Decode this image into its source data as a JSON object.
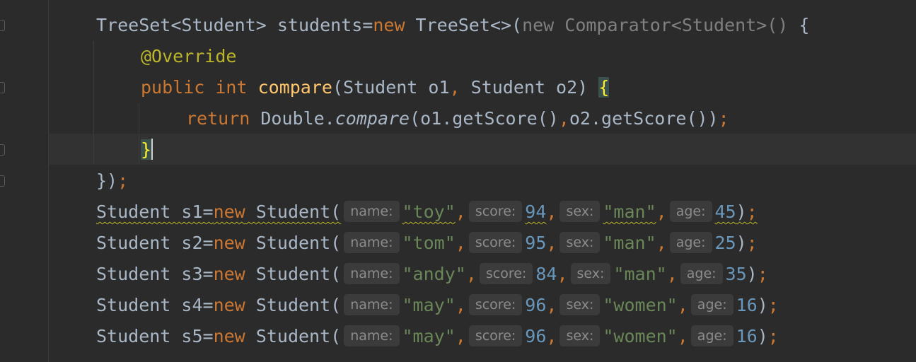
{
  "code": {
    "treeset_decl": {
      "type": "TreeSet<Student>",
      "var": " students=",
      "kw_new": "new",
      "ctor": " TreeSet<>",
      "paren_open": "(",
      "anon": "new Comparator<Student>()",
      "brace": " {"
    },
    "override": "@Override",
    "method_sig": {
      "kw_public": "public",
      "kw_int": "int",
      "name": "compare",
      "params": "(Student o1",
      "comma": ",",
      "params2": " Student o2) ",
      "brace": "{"
    },
    "return_line": {
      "kw_return": "return",
      "cls": " Double.",
      "method": "compare",
      "args": "(o1.getScore()",
      "comma": ",",
      "args2": "o2.getScore())",
      "semi": ";"
    },
    "close_brace": "}",
    "close_anon": "})",
    "close_semi": ";",
    "students": [
      {
        "decl": "Student s1=",
        "kw": "new",
        "ctor": " Student(",
        "name_hint": "name:",
        "name": "\"toy\"",
        "score_hint": "score:",
        "score": "94",
        "sex_hint": "sex:",
        "sex": "\"man\"",
        "age_hint": "age:",
        "age": "45"
      },
      {
        "decl": "Student s2=",
        "kw": "new",
        "ctor": " Student(",
        "name_hint": "name:",
        "name": "\"tom\"",
        "score_hint": "score:",
        "score": "95",
        "sex_hint": "sex:",
        "sex": "\"man\"",
        "age_hint": "age:",
        "age": "25"
      },
      {
        "decl": "Student s3=",
        "kw": "new",
        "ctor": " Student(",
        "name_hint": "name:",
        "name": "\"andy\"",
        "score_hint": "score:",
        "score": "84",
        "sex_hint": "sex:",
        "sex": "\"man\"",
        "age_hint": "age:",
        "age": "35"
      },
      {
        "decl": "Student s4=",
        "kw": "new",
        "ctor": " Student(",
        "name_hint": "name:",
        "name": "\"may\"",
        "score_hint": "score:",
        "score": "96",
        "sex_hint": "sex:",
        "sex": "\"women\"",
        "age_hint": "age:",
        "age": "16"
      },
      {
        "decl": "Student s5=",
        "kw": "new",
        "ctor": " Student(",
        "name_hint": "name:",
        "name": "\"may\"",
        "score_hint": "score:",
        "score": "96",
        "sex_hint": "sex:",
        "sex": "\"women\"",
        "age_hint": "age:",
        "age": "16"
      }
    ],
    "comma": ",",
    "close_paren": ")",
    "semi": ";"
  },
  "colors": {
    "background": "#2b2b2b",
    "keyword": "#cc7832",
    "method": "#ffc66d",
    "annotation": "#bbb529",
    "string": "#6a8759",
    "number": "#6897bb",
    "text": "#a9b7c6"
  }
}
